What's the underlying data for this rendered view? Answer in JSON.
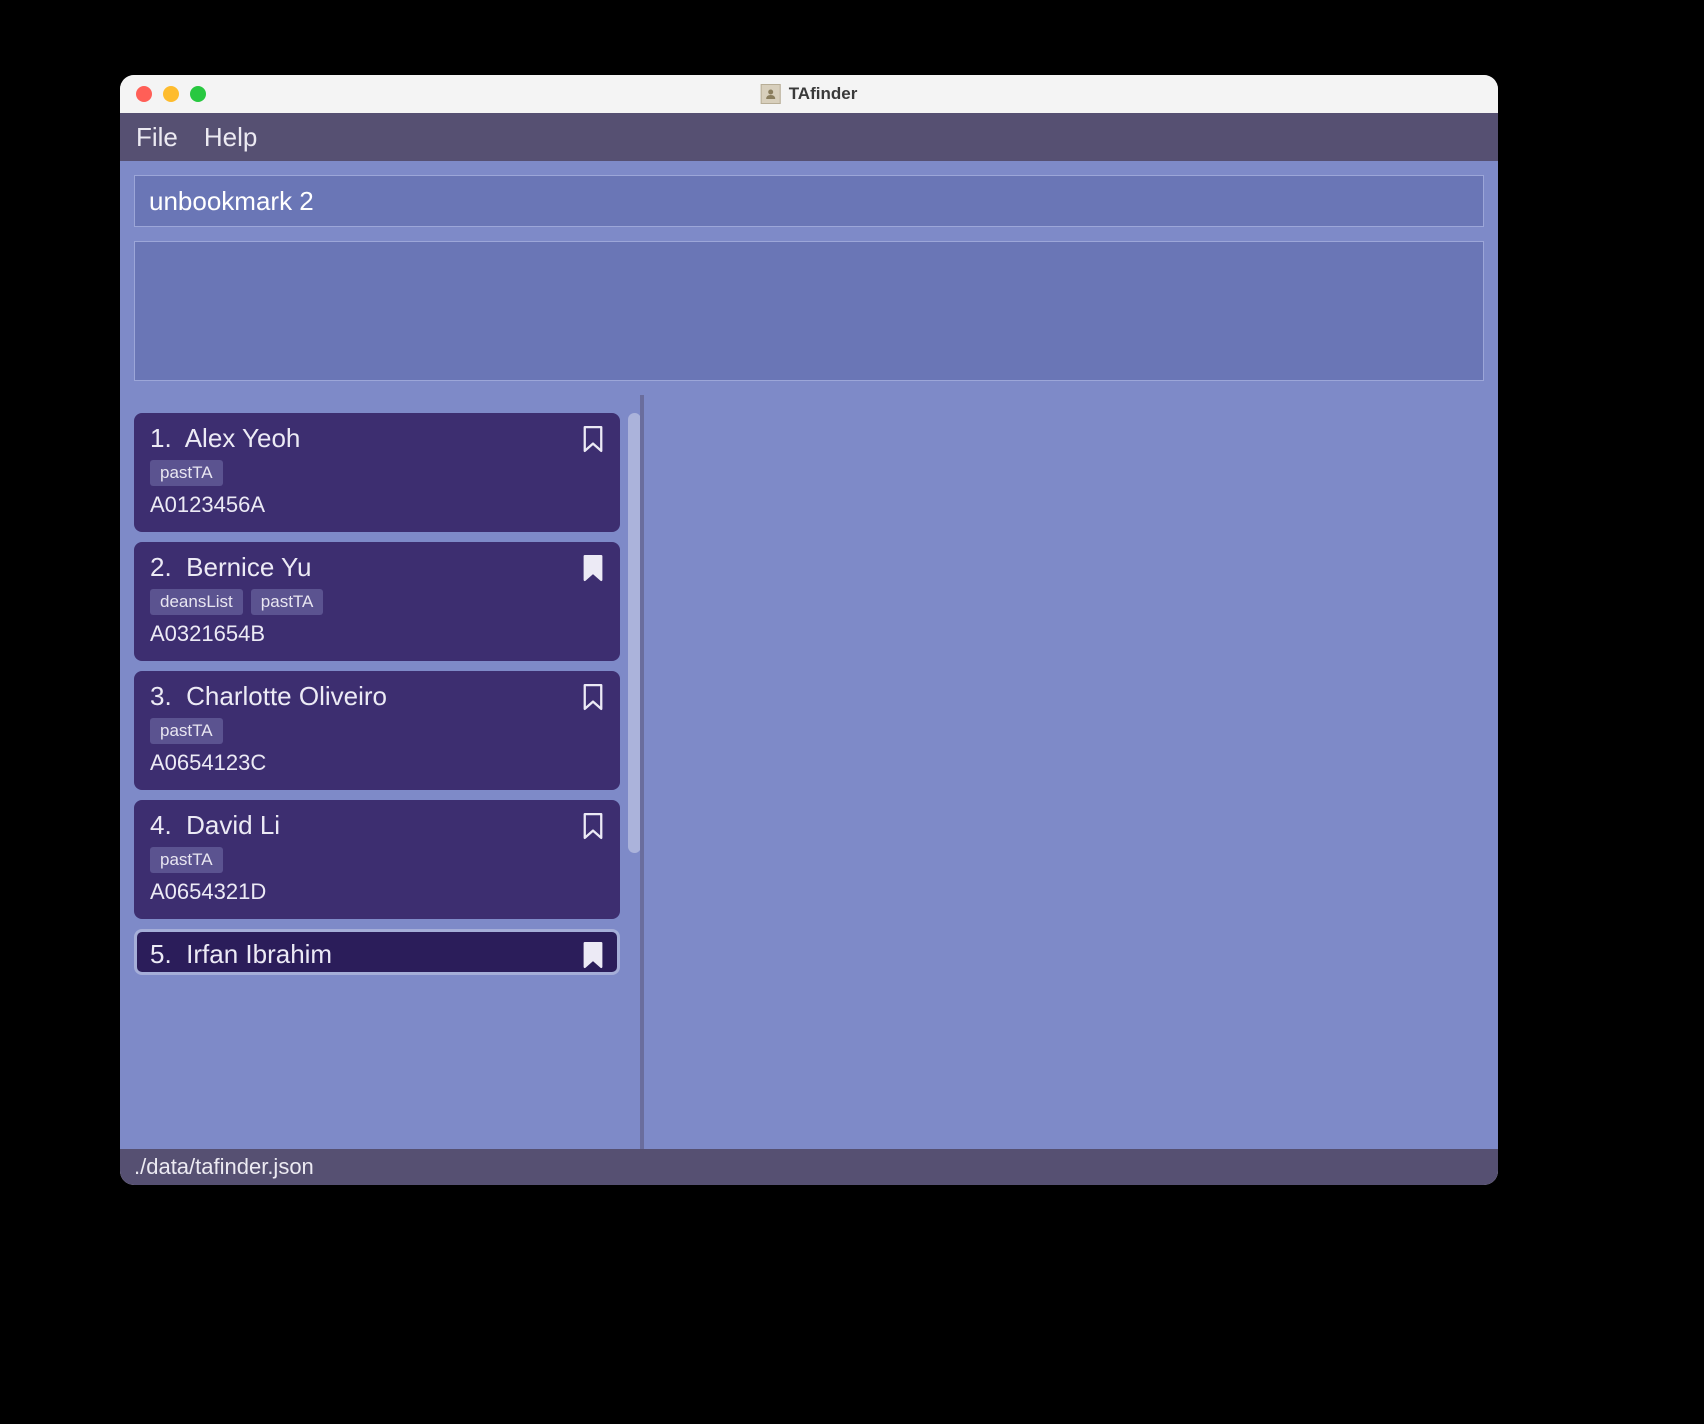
{
  "window": {
    "title": "TAfinder"
  },
  "menubar": {
    "items": [
      {
        "label": "File"
      },
      {
        "label": "Help"
      }
    ]
  },
  "command_input": {
    "value": "unbookmark 2"
  },
  "persons": [
    {
      "index": "1.",
      "name": "Alex Yeoh",
      "tags": [
        "pastTA"
      ],
      "id": "A0123456A",
      "bookmarked": false,
      "selected": false
    },
    {
      "index": "2.",
      "name": "Bernice Yu",
      "tags": [
        "deansList",
        "pastTA"
      ],
      "id": "A0321654B",
      "bookmarked": true,
      "selected": false
    },
    {
      "index": "3.",
      "name": "Charlotte Oliveiro",
      "tags": [
        "pastTA"
      ],
      "id": "A0654123C",
      "bookmarked": false,
      "selected": false
    },
    {
      "index": "4.",
      "name": "David Li",
      "tags": [
        "pastTA"
      ],
      "id": "A0654321D",
      "bookmarked": false,
      "selected": false
    },
    {
      "index": "5.",
      "name": "Irfan Ibrahim",
      "tags": [],
      "id": "",
      "bookmarked": true,
      "selected": true
    }
  ],
  "statusbar": {
    "path": "./data/tafinder.json"
  }
}
